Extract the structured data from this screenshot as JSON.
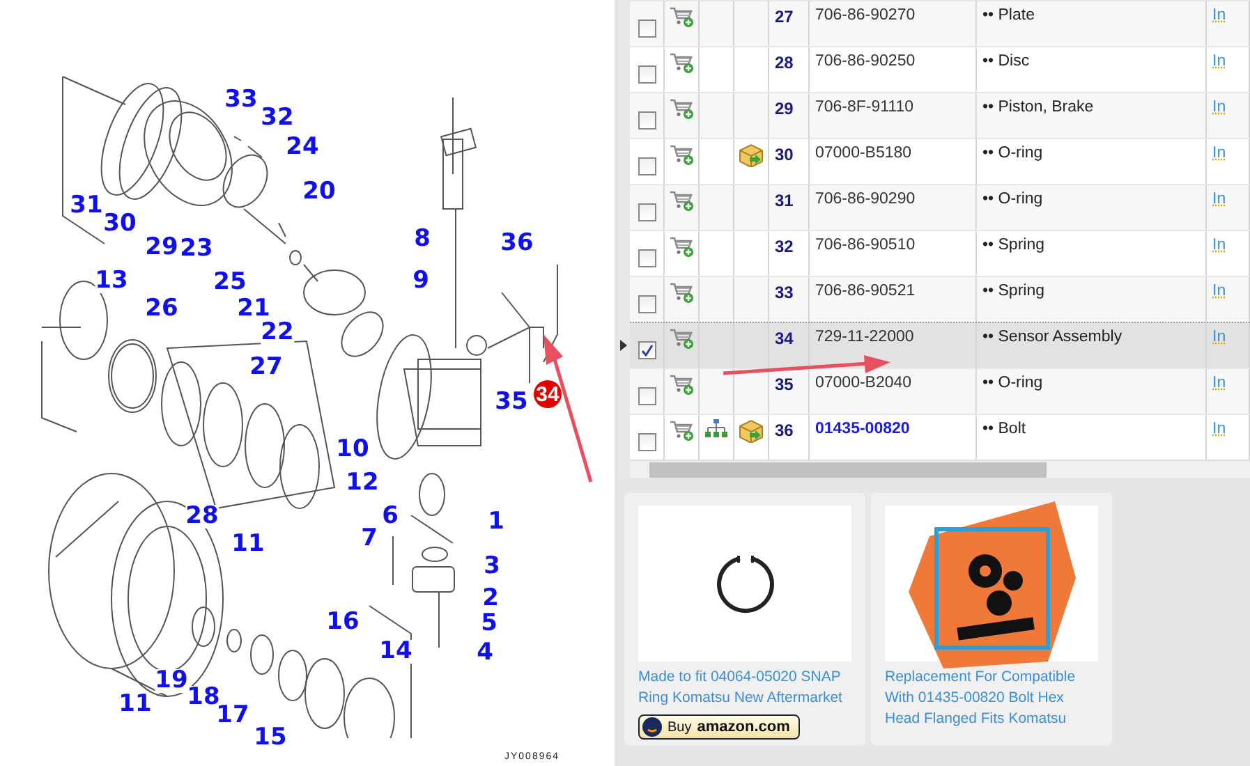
{
  "diagram": {
    "labels": [
      "33",
      "32",
      "24",
      "20",
      "31",
      "30",
      "29",
      "23",
      "25",
      "21",
      "22",
      "13",
      "26",
      "27",
      "8",
      "9",
      "36",
      "35",
      "10",
      "12",
      "6",
      "1",
      "7",
      "3",
      "2",
      "5",
      "4",
      "11",
      "28",
      "19",
      "18",
      "11",
      "17",
      "15",
      "16",
      "14"
    ],
    "highlight": {
      "label": "34",
      "color": "#e00000"
    },
    "code": "JY008964"
  },
  "table": {
    "rows": [
      {
        "item": "27",
        "part_no": "706-86-90270",
        "description": "•• Plate",
        "link": "In",
        "checked": false,
        "selected": false,
        "part_link": false,
        "sub_assembly": false,
        "replacement": false
      },
      {
        "item": "28",
        "part_no": "706-86-90250",
        "description": "•• Disc",
        "link": "In",
        "checked": false,
        "selected": false,
        "part_link": false,
        "sub_assembly": false,
        "replacement": false
      },
      {
        "item": "29",
        "part_no": "706-8F-91110",
        "description": "•• Piston, Brake",
        "link": "In",
        "checked": false,
        "selected": false,
        "part_link": false,
        "sub_assembly": false,
        "replacement": false
      },
      {
        "item": "30",
        "part_no": "07000-B5180",
        "description": "•• O-ring",
        "link": "In",
        "checked": false,
        "selected": false,
        "part_link": false,
        "sub_assembly": false,
        "replacement": true
      },
      {
        "item": "31",
        "part_no": "706-86-90290",
        "description": "•• O-ring",
        "link": "In",
        "checked": false,
        "selected": false,
        "part_link": false,
        "sub_assembly": false,
        "replacement": false
      },
      {
        "item": "32",
        "part_no": "706-86-90510",
        "description": "•• Spring",
        "link": "In",
        "checked": false,
        "selected": false,
        "part_link": false,
        "sub_assembly": false,
        "replacement": false
      },
      {
        "item": "33",
        "part_no": "706-86-90521",
        "description": "•• Spring",
        "link": "In",
        "checked": false,
        "selected": false,
        "part_link": false,
        "sub_assembly": false,
        "replacement": false
      },
      {
        "item": "34",
        "part_no": "729-11-22000",
        "description": "•• Sensor Assembly",
        "link": "In",
        "checked": true,
        "selected": true,
        "part_link": false,
        "sub_assembly": false,
        "replacement": false
      },
      {
        "item": "35",
        "part_no": "07000-B2040",
        "description": "•• O-ring",
        "link": "In",
        "checked": false,
        "selected": false,
        "part_link": false,
        "sub_assembly": false,
        "replacement": false
      },
      {
        "item": "36",
        "part_no": "01435-00820",
        "description": "•• Bolt",
        "link": "In",
        "checked": false,
        "selected": false,
        "part_link": true,
        "sub_assembly": true,
        "replacement": true
      }
    ]
  },
  "products": [
    {
      "kind": "ring",
      "title": "Made to fit 04064-05020 SNAP Ring Komatsu New Aftermarket",
      "buy_button": {
        "label": "Buy",
        "store": "amazon.com"
      }
    },
    {
      "kind": "coming-soon",
      "title": "Replacement For Compatible With 01435-00820 Bolt Hex Head Flanged Fits Komatsu"
    }
  ]
}
